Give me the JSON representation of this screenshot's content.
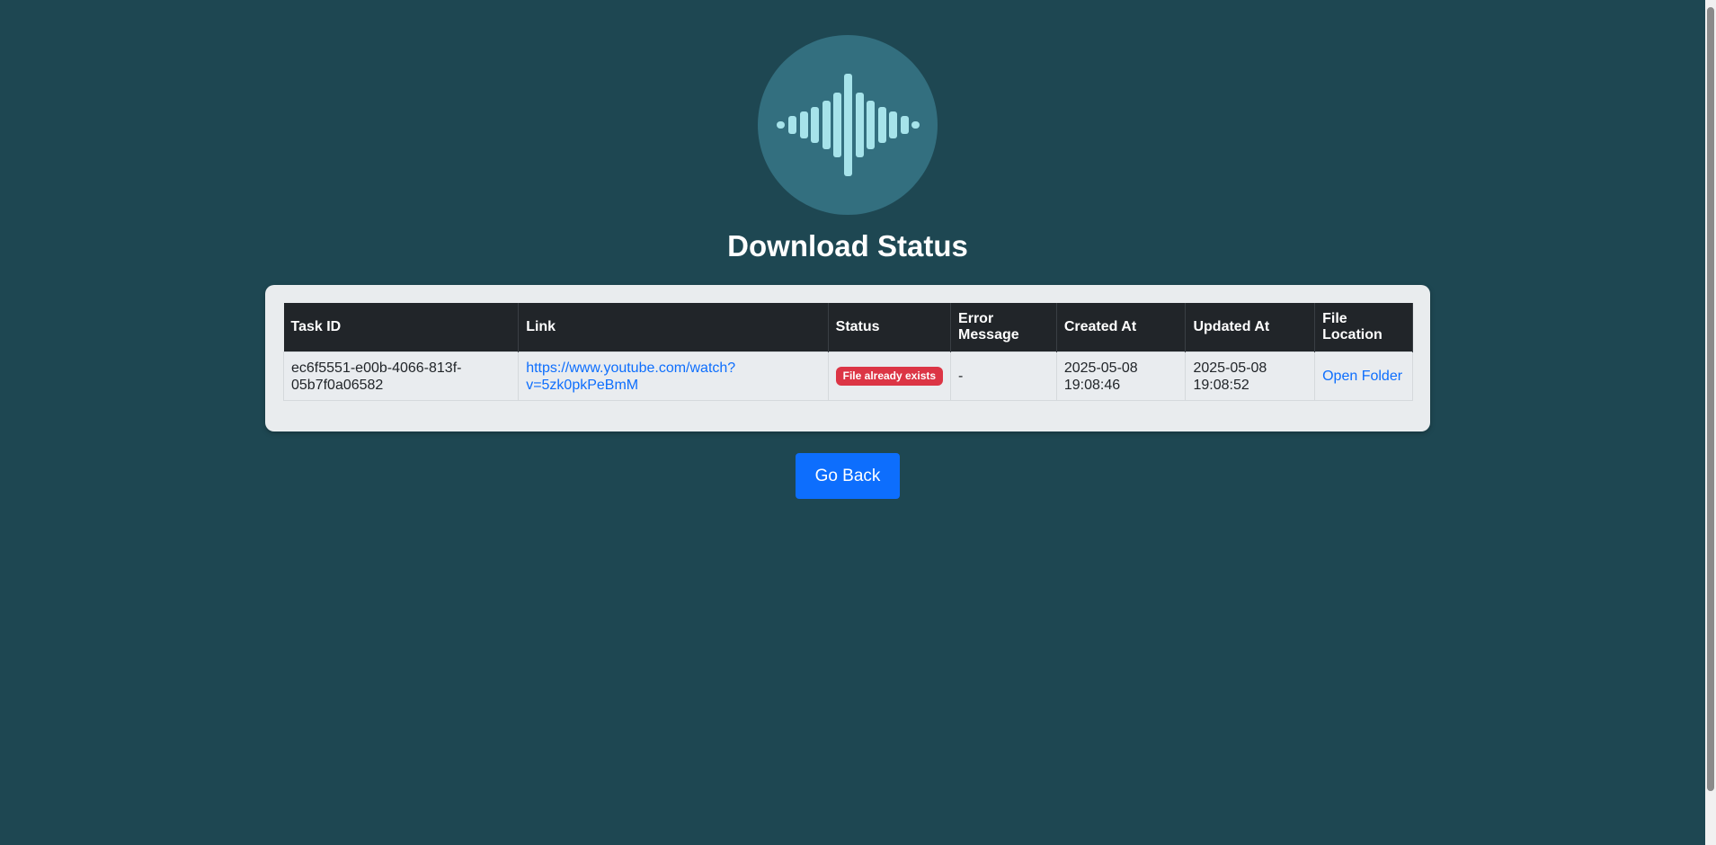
{
  "logo": {
    "icon": "sound-wave-icon",
    "circle_color": "#336f7f",
    "wave_color": "#a6e3ea"
  },
  "page_title": "Download Status",
  "table": {
    "headers": [
      "Task ID",
      "Link",
      "Status",
      "Error Message",
      "Created At",
      "Updated At",
      "File Location"
    ],
    "rows": [
      {
        "task_id": "ec6f5551-e00b-4066-813f-05b7f0a06582",
        "link": "https://www.youtube.com/watch?v=5zk0pkPeBmM",
        "status": "File already exists",
        "error_message": "-",
        "created_at": "2025-05-08 19:08:46",
        "updated_at": "2025-05-08 19:08:52",
        "file_location": "Open Folder"
      }
    ]
  },
  "go_back_label": "Go Back",
  "colors": {
    "background": "#1e4752",
    "card": "#e9ecee",
    "header": "#212529",
    "link": "#0d6efd",
    "badge": "#dc3545",
    "button": "#0d6efd"
  }
}
